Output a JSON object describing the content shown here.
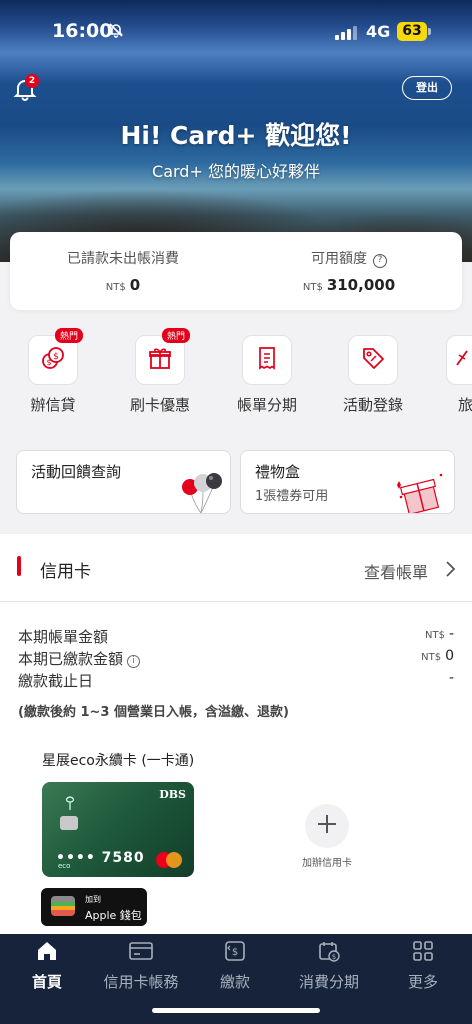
{
  "status_bar": {
    "time": "16:00",
    "network": "4G",
    "battery": "63"
  },
  "header": {
    "notification_count": "2",
    "logout_label": "登出",
    "greeting": "Hi! Card+ 歡迎您!",
    "subtitle": "Card+ 您的暖心好夥伴"
  },
  "balance": {
    "unbilled_label": "已請款未出帳消費",
    "unbilled_currency": "NT$",
    "unbilled_value": "0",
    "available_label": "可用額度",
    "available_currency": "NT$",
    "available_value": "310,000"
  },
  "quick_menu": [
    {
      "label": "辦信貸",
      "badge": "熱門",
      "icon": "coins-icon"
    },
    {
      "label": "刷卡優惠",
      "badge": "熱門",
      "icon": "gift-icon"
    },
    {
      "label": "帳單分期",
      "icon": "receipt-icon"
    },
    {
      "label": "活動登錄",
      "icon": "tag-icon"
    },
    {
      "label": "旅",
      "icon": "travel-icon"
    }
  ],
  "promos": [
    {
      "title": "活動回饋查詢",
      "subtitle": ""
    },
    {
      "title": "禮物盒",
      "subtitle": "1張禮券可用"
    }
  ],
  "credit_card": {
    "section_title": "信用卡",
    "view_bill_label": "查看帳單",
    "rows": [
      {
        "label": "本期帳單金額",
        "currency": "NT$",
        "value": "-"
      },
      {
        "label": "本期已繳款金額",
        "currency": "NT$",
        "value": "0"
      },
      {
        "label": "繳款截止日",
        "currency": "",
        "value": "-"
      }
    ],
    "note": "(繳款後約 1~3 個營業日入帳，含溢繳、退款)",
    "card_name": "星展eco永續卡 (一卡通)",
    "card_brand": "DBS",
    "card_last4": "•••• 7580",
    "card_eco": "eco",
    "wallet_line1": "加到",
    "wallet_line2": "Apple 錢包",
    "add_card_label": "加辦信用卡"
  },
  "tabbar": [
    {
      "label": "首頁",
      "icon": "home-icon",
      "active": true
    },
    {
      "label": "信用卡帳務",
      "icon": "card-icon"
    },
    {
      "label": "繳款",
      "icon": "payment-icon"
    },
    {
      "label": "消費分期",
      "icon": "calendar-dollar-icon"
    },
    {
      "label": "更多",
      "icon": "grid-icon"
    }
  ],
  "colors": {
    "accent": "#e3001b",
    "tabbar": "#16233b",
    "battery": "#f5d90a"
  }
}
